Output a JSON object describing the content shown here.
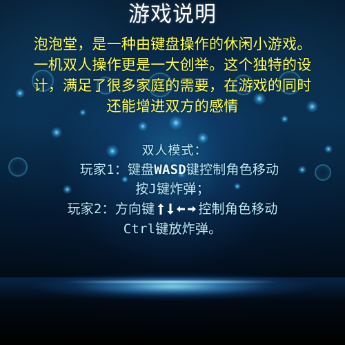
{
  "screen": {
    "title": "游戏说明",
    "intro_lines": [
      "泡泡堂，是一种由键盘操作的休闲小游戏。",
      "一机双人操作更是一大创举。这个独特的设",
      "计，满足了很多家庭的需要，在游戏的同时",
      "还能增进双方的感情"
    ],
    "mode_title": "双人模式：",
    "player1_line": {
      "prefix": "玩家1：键盘",
      "keys": "WASD",
      "suffix": "键控制角色移动"
    },
    "player1_bomb": "按J键炸弹；",
    "player2_line": {
      "prefix": "玩家2：方向键",
      "suffix": "控制角色移动"
    },
    "player2_bomb": "Ctrl键放炸弹。",
    "icons": {
      "up": "arrow-up-icon",
      "down": "arrow-down-icon",
      "left": "arrow-left-icon",
      "right": "arrow-right-icon"
    },
    "colors": {
      "title": "#ffffff",
      "intro": "#ffff52",
      "instructions": "#b9ecff"
    }
  }
}
